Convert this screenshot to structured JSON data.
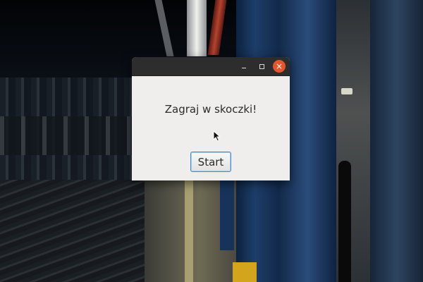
{
  "window": {
    "prompt_text": "Zagraj w skoczki!",
    "start_label": "Start",
    "controls": {
      "minimize_icon": "minimize-icon",
      "maximize_icon": "maximize-icon",
      "close_icon": "close-icon",
      "close_glyph": "×"
    }
  },
  "colors": {
    "titlebar": "#2d2d2d",
    "window_body": "#efeeec",
    "close_button": "#e2552d",
    "focus_ring": "#3b8fd8"
  }
}
